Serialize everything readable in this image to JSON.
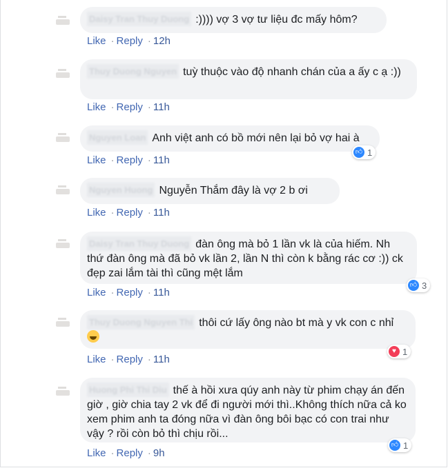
{
  "actions": {
    "like": "Like",
    "reply": "Reply",
    "dot": "·"
  },
  "comments": [
    {
      "author": "Daisy Tran Thuy Duong",
      "text": ":)))) vợ 3 vợ tư liệu đc mấy hôm?",
      "time": "12h"
    },
    {
      "author": "Thuy Duong Nguyen",
      "text": "tuỳ thuộc vào độ nhanh chán của a ấy c ạ :))",
      "time": "11h"
    },
    {
      "author": "Nguyen Loan",
      "text": "Anh việt anh có bồ mới nên lại bỏ vợ hai à",
      "time": "11h",
      "reaction_icon": "like-icon",
      "reaction_count": "1"
    },
    {
      "author": "Nguyen Huong",
      "text": "Nguyễn Thắm đây là vợ 2 b ơi",
      "time": "11h"
    },
    {
      "author": "Daisy Tran Thuy Duong",
      "text": "đàn ông mà bỏ 1 lần vk là của hiếm. Nh thứ đàn ông mà đã bỏ vk lần 2, lần N thì còn k bằng rác cơ :)) ck đẹp zai lắm tài thì cũng mệt lắm",
      "time": "11h",
      "reaction_icon": "like-icon",
      "reaction_count": "3"
    },
    {
      "author": "Thuy Duong Nguyen Thi",
      "text": "thôi cứ lấy ông nào bt mà y vk con c nhỉ",
      "emoji": "laughing-tears-emoji",
      "time": "11h",
      "reaction_icon": "love-icon",
      "reaction_count": "1"
    },
    {
      "author": "Huong Phi Thi Diu",
      "text": "thế à hồi xưa qúy anh này từ phim chạy án đến giờ , giờ chia tay 2 vk để đi người mới thì..Không thích nữa cả ko xem phim anh ta đóng nữa vì đàn ông bôi bạc có con trai như vậy ? rồi còn bỏ thì chịu rồi...",
      "time": "9h",
      "reaction_icon": "like-icon",
      "reaction_count": "1"
    }
  ],
  "colors": {
    "link": "#4267b2",
    "bubble": "#f2f3f5",
    "like": "#2d88ff",
    "love": "#f33e58"
  }
}
